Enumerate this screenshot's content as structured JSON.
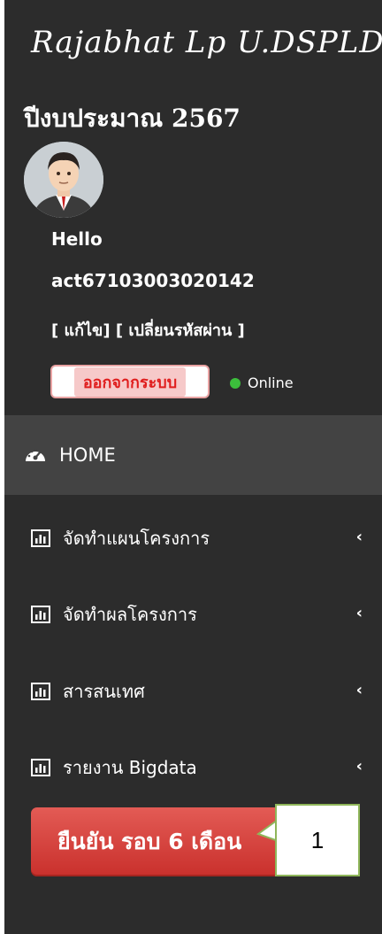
{
  "sidebar": {
    "brand": "Rajabhat Lp U.DSPLD.",
    "fiscal_year": "ปีงบประมาณ 2567",
    "user": {
      "greeting": "Hello",
      "username": "act67103003020142",
      "edit_link": "[ แก้ไข]",
      "change_password_link": "[ เปลี่ยนรหัสผ่าน ]",
      "logout_label": "ออกจากระบบ",
      "status": "Online"
    },
    "home_label": "HOME",
    "items": [
      {
        "label": "จัดทำแผนโครงการ",
        "icon": "bar-chart-icon"
      },
      {
        "label": "จัดทำผลโครงการ",
        "icon": "bar-chart-icon"
      },
      {
        "label": "สารสนเทศ",
        "icon": "bar-chart-icon"
      },
      {
        "label": "รายงาน Bigdata",
        "icon": "bar-chart-icon"
      }
    ],
    "confirm_button_label": "ยืนยัน รอบ 6 เดือน"
  },
  "annotation": {
    "label": "1"
  },
  "colors": {
    "sidebar_bg": "#2c2c2c",
    "home_bg": "#434343",
    "confirm_button": "#d9403a",
    "logout_text": "#e01d1d",
    "online_dot": "#3cbf3c",
    "callout_border": "#8fb65a"
  }
}
